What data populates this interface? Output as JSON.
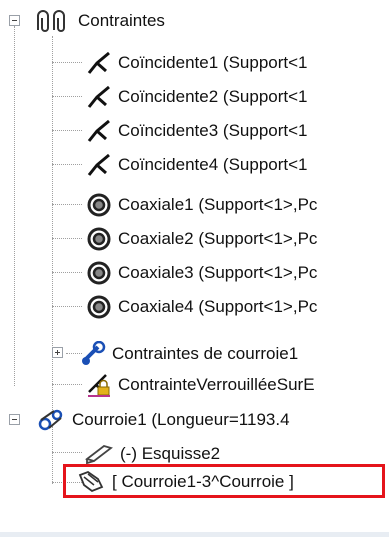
{
  "tree": {
    "root": {
      "label": "Contraintes",
      "icon": "mates-folder-icon"
    },
    "mates": [
      {
        "label": "Coïncidente1 (Support<1",
        "icon": "coincident-mate-icon"
      },
      {
        "label": "Coïncidente2 (Support<1",
        "icon": "coincident-mate-icon"
      },
      {
        "label": "Coïncidente3 (Support<1",
        "icon": "coincident-mate-icon"
      },
      {
        "label": "Coïncidente4 (Support<1",
        "icon": "coincident-mate-icon"
      },
      {
        "label": "Coaxiale1 (Support<1>,Pc",
        "icon": "concentric-mate-icon"
      },
      {
        "label": "Coaxiale2 (Support<1>,Pc",
        "icon": "concentric-mate-icon"
      },
      {
        "label": "Coaxiale3 (Support<1>,Pc",
        "icon": "concentric-mate-icon"
      },
      {
        "label": "Coaxiale4 (Support<1>,Pc",
        "icon": "concentric-mate-icon"
      }
    ],
    "belt_mates": {
      "label": "Contraintes de courroie1",
      "icon": "belt-mate-icon"
    },
    "locked_mate": {
      "label": "ContrainteVerrouilléeSurE",
      "icon": "locked-mate-icon"
    },
    "belt": {
      "label": "Courroie1 (Longueur=1193.4",
      "icon": "belt-chain-icon",
      "children": [
        {
          "label": "(-) Esquisse2",
          "icon": "sketch-icon"
        },
        {
          "label": "[ Courroie1-3^Courroie ]",
          "icon": "belt-part-icon"
        }
      ]
    }
  },
  "colors": {
    "highlight": "#e5141b",
    "line": "#a0a0a0"
  }
}
